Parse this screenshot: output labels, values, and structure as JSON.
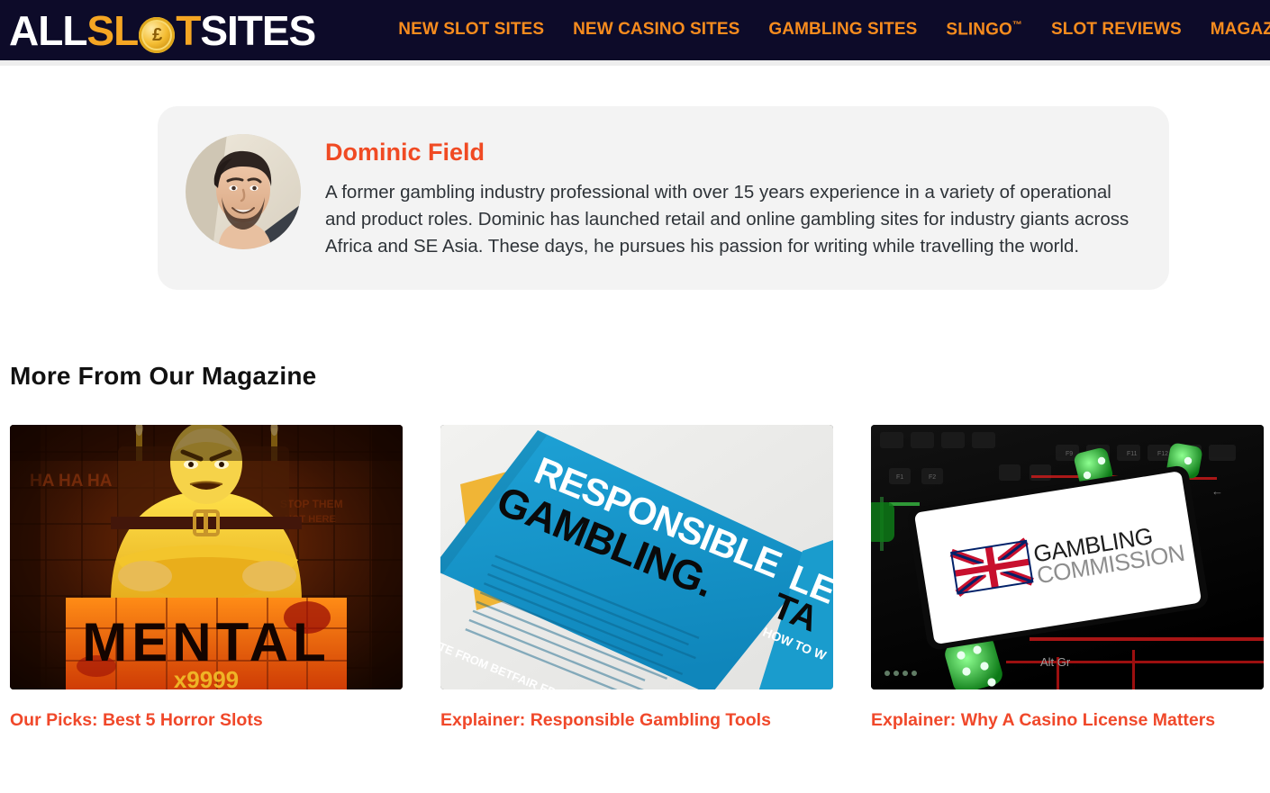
{
  "header": {
    "logo": {
      "part1": "ALL",
      "part2": "SL",
      "coin_icon": "gold-coin-icon",
      "part3": "T",
      "part4": "SITES",
      "colors": {
        "white": "#ffffff",
        "gold": "#f5a623",
        "bar": "#0d0b29"
      }
    },
    "nav": [
      {
        "label": "NEW SLOT SITES",
        "name": "nav-new-slot-sites"
      },
      {
        "label": "NEW CASINO SITES",
        "name": "nav-new-casino-sites"
      },
      {
        "label": "GAMBLING SITES",
        "name": "nav-gambling-sites"
      },
      {
        "label": "SLINGO",
        "trademark": "™",
        "name": "nav-slingo"
      },
      {
        "label": "SLOT REVIEWS",
        "name": "nav-slot-reviews"
      },
      {
        "label": "MAGAZ",
        "name": "nav-magazine"
      }
    ],
    "nav_color": "#f78c1e"
  },
  "author": {
    "avatar_alt": "Portrait photo of Dominic Field",
    "name": "Dominic Field",
    "name_color": "#f04a23",
    "bio": "A former gambling industry professional with over 15 years experience in a variety of operational and product roles. Dominic has launched retail and online gambling sites for industry giants across Africa and SE Asia. These days, he pursues his passion for writing while travelling the world.",
    "card_background": "#f3f3f3"
  },
  "magazine": {
    "heading": "More From Our Magazine",
    "link_color": "#f0482a",
    "cards": [
      {
        "title": "Our Picks: Best 5 Horror Slots",
        "image_alt": "Mental slot game artwork showing a figure in a straitjacket",
        "image_text_1": "HA HA HA",
        "image_text_2": "MENTAL",
        "image_text_3": "x9999"
      },
      {
        "title": "Explainer: Responsible Gambling Tools",
        "image_alt": "Blue responsible gambling leaflets on a white surface",
        "image_text_1": "RESPONSIBLE",
        "image_text_2": "GAMBLING.",
        "image_text_3": "LE TA",
        "image_text_4": "HOW TO W",
        "image_text_5": "OTE FROM BETFAIR ED"
      },
      {
        "title": "Explainer: Why A Casino License Matters",
        "image_alt": "Smartphone displaying the UK Gambling Commission logo on a backlit keyboard with green dice",
        "image_text_1": "GAMBLING",
        "image_text_2": "COMMISSION",
        "image_text_3": "Alt Gr"
      }
    ]
  }
}
